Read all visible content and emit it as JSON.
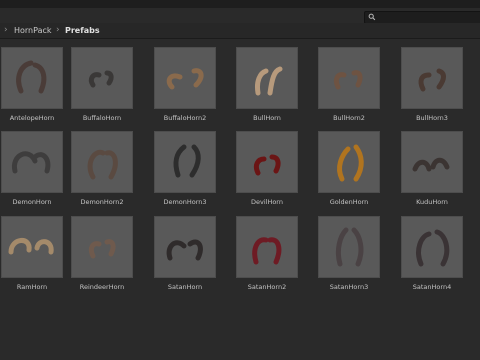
{
  "breadcrumb": {
    "parent": "HornPack",
    "current": "Prefabs"
  },
  "search": {
    "icon": "search-icon",
    "value": ""
  },
  "assets": [
    {
      "label": "AntelopeHorn",
      "color": "#4a3c38"
    },
    {
      "label": "BuffaloHorn",
      "color": "#3a3837"
    },
    {
      "label": "BuffaloHorn2",
      "color": "#8a6a4c"
    },
    {
      "label": "BullHorn",
      "color": "#b79a7c"
    },
    {
      "label": "BullHorn2",
      "color": "#6e5342"
    },
    {
      "label": "BullHorn3",
      "color": "#4a3a33"
    },
    {
      "label": "DemonHorn",
      "color": "#3e3d3d"
    },
    {
      "label": "DemonHorn2",
      "color": "#5a4a41"
    },
    {
      "label": "DemonHorn3",
      "color": "#2d2d2d"
    },
    {
      "label": "DevilHorn",
      "color": "#6b1515"
    },
    {
      "label": "GoldenHorn",
      "color": "#b0741f"
    },
    {
      "label": "KuduHorn",
      "color": "#3b3432"
    },
    {
      "label": "RamHorn",
      "color": "#a48a6a"
    },
    {
      "label": "ReindeerHorn",
      "color": "#6f5a4d"
    },
    {
      "label": "SatanHorn",
      "color": "#2f2b2b"
    },
    {
      "label": "SatanHorn2",
      "color": "#6e1b24"
    },
    {
      "label": "SatanHorn3",
      "color": "#4a4244"
    },
    {
      "label": "SatanHorn4",
      "color": "#3a3335"
    }
  ]
}
